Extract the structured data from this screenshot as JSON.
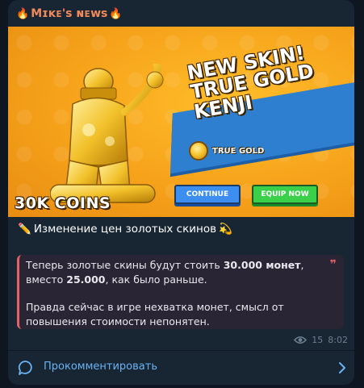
{
  "channel": {
    "name": "Mɪᴋᴇ's ɴᴇᴡs",
    "icon_left": "fire-icon",
    "icon_right": "fire-icon"
  },
  "image": {
    "headline_line1": "NEW SKIN!",
    "headline_line2": "TRUE GOLD",
    "headline_line3": "KENJI",
    "badge_label": "TRUE GOLD",
    "coins_label": "30K COINS",
    "button_continue": "CONTINUE",
    "button_equip": "EQUIP NOW"
  },
  "post": {
    "title_icon": "✏️",
    "title": "Изменение цен золотых скинов",
    "title_icon_after": "💫",
    "quote_part1": "Теперь золотые скины будут стоить ",
    "quote_bold1": "30.000 монет",
    "quote_part2": ", вместо ",
    "quote_bold2": "25.000",
    "quote_part3": ", как было раньше.",
    "quote_para2": "Правда сейчас в игре нехватка монет, смысл от повышения стоимости непонятен.",
    "views": "15",
    "time": "8:02"
  },
  "comments": {
    "label": "Прокомментировать"
  },
  "colors": {
    "background": "#0e1621",
    "bubble": "#182533",
    "channel_name": "#f08a5a",
    "quote_accent": "#e4606a",
    "link": "#6ab3f3"
  }
}
